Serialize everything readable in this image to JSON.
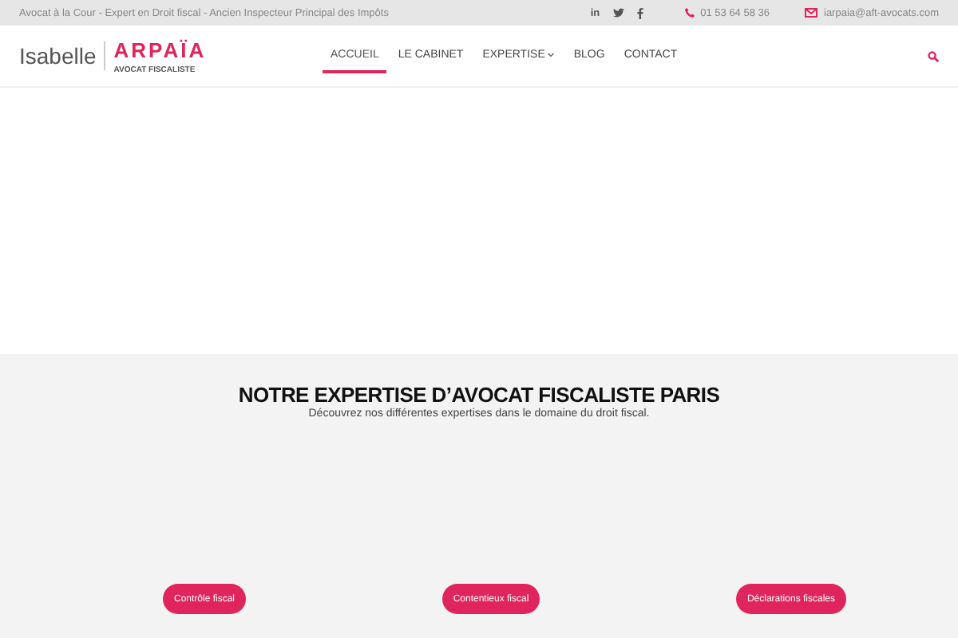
{
  "top_bar": {
    "tagline": "Avocat à la Cour - Expert en Droit fiscal - Ancien Inspecteur Principal des Impôts",
    "social": [
      "in"
    ],
    "phone": "01 53 64 58 36",
    "email": "iarpaia@aft-avocats.com"
  },
  "header": {
    "logo_first": "Isabelle",
    "logo_last": "ARPAÏA",
    "logo_sub": "AVOCAT FISCALISTE",
    "nav": [
      {
        "label": "ACCUEIL",
        "selected": true,
        "dropdown": false
      },
      {
        "label": "LE CABINET",
        "selected": false,
        "dropdown": false
      },
      {
        "label": "EXPERTISE",
        "selected": false,
        "dropdown": true
      },
      {
        "label": "BLOG",
        "selected": false,
        "dropdown": false
      },
      {
        "label": "CONTACT",
        "selected": false,
        "dropdown": false
      }
    ]
  },
  "section": {
    "title": "NOTRE EXPERTISE D’AVOCAT FISCALISTE PARIS",
    "subtitle": "Découvrez nos différentes expertises dans le domaine du droit fiscal.",
    "buttons": [
      "Contrôle fiscal",
      "Contentieux fiscal",
      "Déclarations fiscales"
    ]
  }
}
